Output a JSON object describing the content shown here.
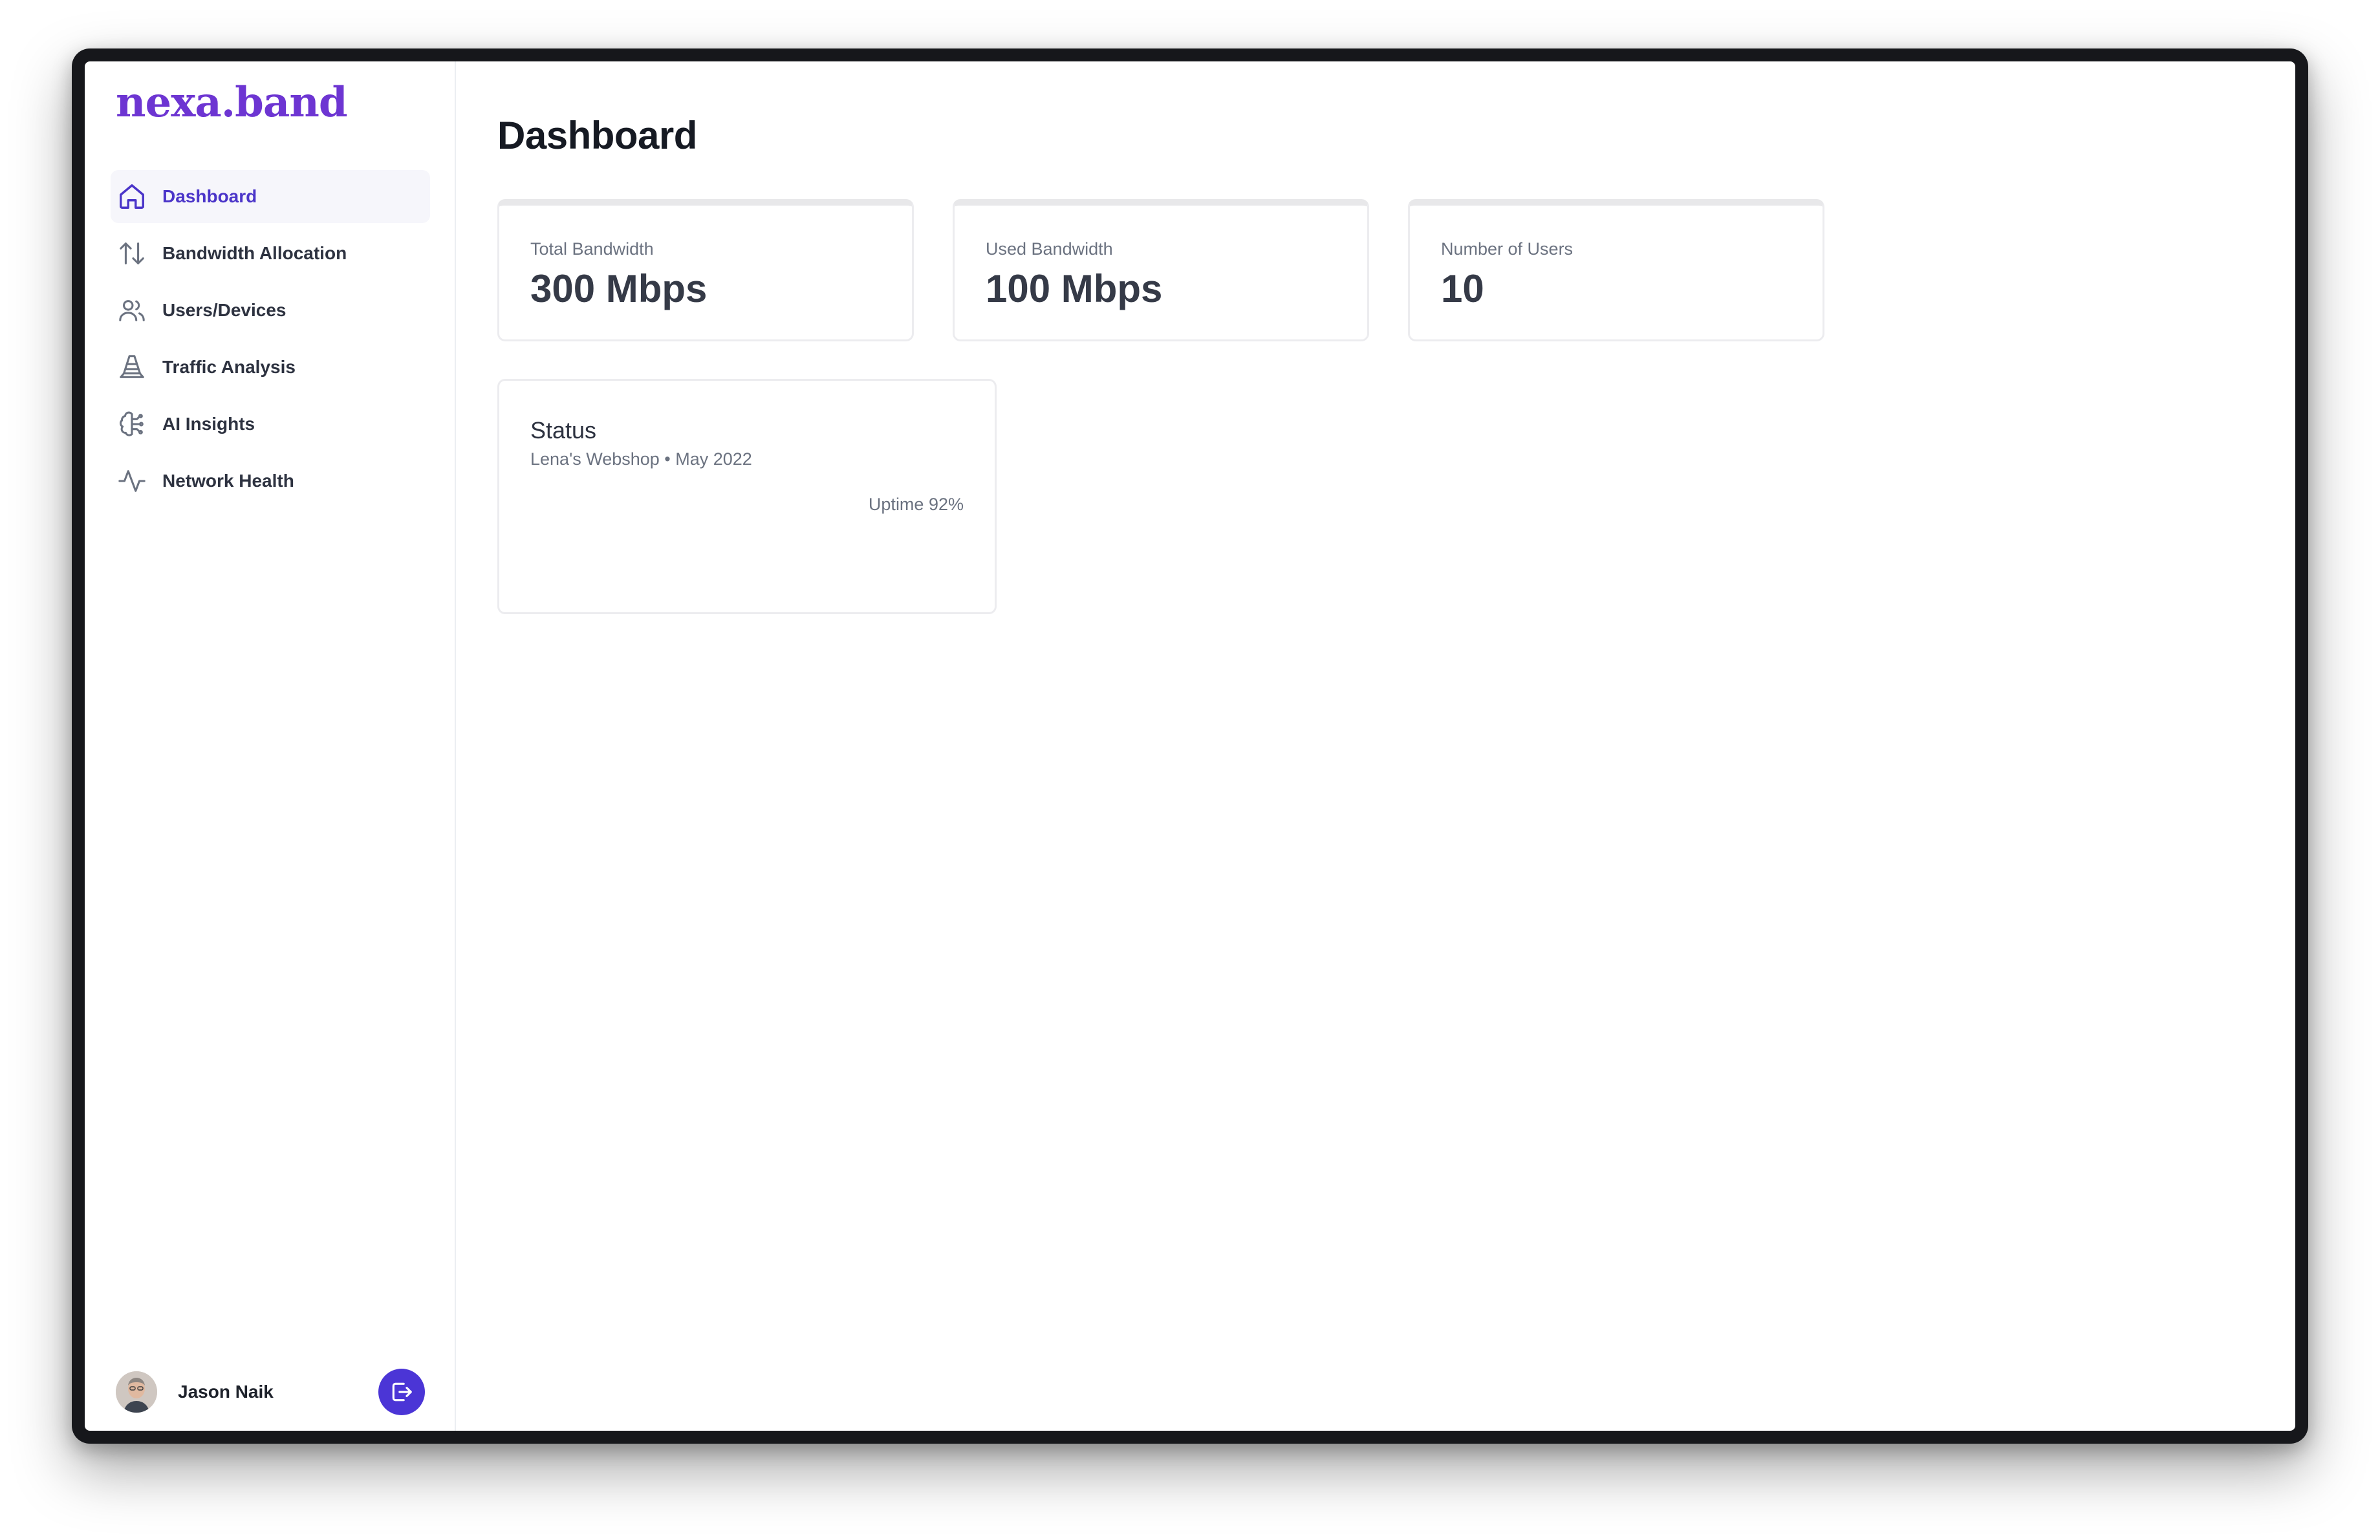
{
  "brand": {
    "name": "nexa.band",
    "color": "#6d35d2"
  },
  "sidebar": {
    "items": [
      {
        "label": "Dashboard",
        "icon": "home-icon",
        "active": true
      },
      {
        "label": "Bandwidth Allocation",
        "icon": "arrows-up-down-icon",
        "active": false
      },
      {
        "label": "Users/Devices",
        "icon": "users-icon",
        "active": false
      },
      {
        "label": "Traffic Analysis",
        "icon": "traffic-cone-icon",
        "active": false
      },
      {
        "label": "AI Insights",
        "icon": "brain-circuit-icon",
        "active": false
      },
      {
        "label": "Network Health",
        "icon": "activity-icon",
        "active": false
      }
    ],
    "accent": "#4b35c9"
  },
  "user": {
    "name": "Jason Naik",
    "avatar_icon": "avatar",
    "logout_icon": "logout-icon"
  },
  "main": {
    "title": "Dashboard",
    "stats": [
      {
        "label": "Total Bandwidth",
        "value": "300 Mbps"
      },
      {
        "label": "Used Bandwidth",
        "value": "100 Mbps"
      },
      {
        "label": "Number of Users",
        "value": "10"
      }
    ],
    "status": {
      "title": "Status",
      "subtitle": "Lena's Webshop • May 2022",
      "uptime": "Uptime 92%"
    }
  }
}
